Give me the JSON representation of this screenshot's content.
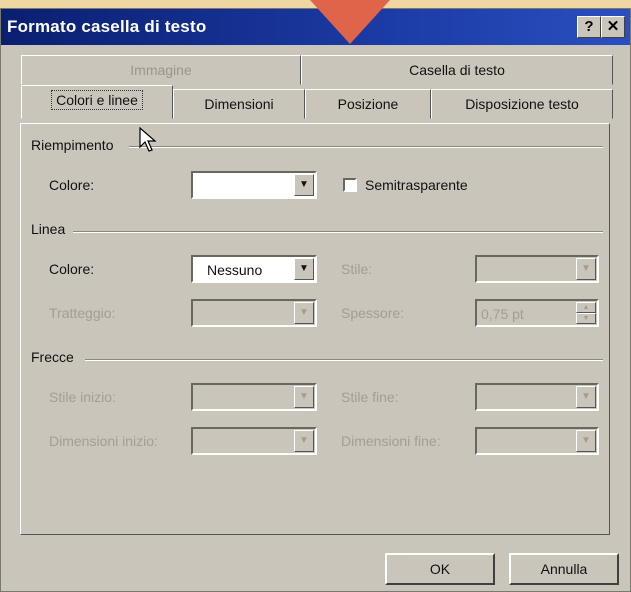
{
  "window": {
    "title": "Formato casella di testo",
    "help_label": "?",
    "close_label": "✕"
  },
  "tabs_back": [
    {
      "label": "Immagine",
      "disabled": true
    },
    {
      "label": "Casella di testo",
      "disabled": false
    }
  ],
  "tabs_front": [
    {
      "label": "Colori e linee",
      "active": true
    },
    {
      "label": "Dimensioni"
    },
    {
      "label": "Posizione"
    },
    {
      "label": "Disposizione testo"
    }
  ],
  "fill": {
    "section": "Riempimento",
    "color_label": "Colore:",
    "color_value": "",
    "semitransparent_label": "Semitrasparente",
    "semitransparent_checked": false
  },
  "line": {
    "section": "Linea",
    "color_label": "Colore:",
    "color_value": "Nessuno",
    "style_label": "Stile:",
    "dash_label": "Tratteggio:",
    "weight_label": "Spessore:",
    "weight_value": "0,75 pt"
  },
  "arrows": {
    "section": "Frecce",
    "begin_style_label": "Stile inizio:",
    "end_style_label": "Stile fine:",
    "begin_size_label": "Dimensioni inizio:",
    "end_size_label": "Dimensioni fine:"
  },
  "buttons": {
    "ok": "OK",
    "cancel": "Annulla"
  },
  "colors": {
    "titlebar": "#0a1f70",
    "pointer_arrow": "#e0644a"
  }
}
